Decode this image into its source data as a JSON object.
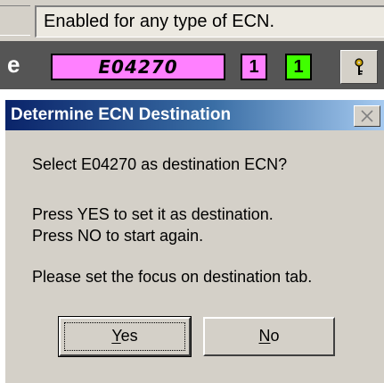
{
  "status_field": {
    "text": "Enabled for any type of ECN."
  },
  "toolbar": {
    "partial_letter": "e",
    "ecn_number": "E04270",
    "count_pink": "1",
    "count_green": "1",
    "key_icon": "key-icon",
    "colors": {
      "band": "#555555",
      "ecn_box": "#ff80ff",
      "count_pink": "#ff80ff",
      "count_green": "#40ff00"
    }
  },
  "dialog": {
    "title": "Determine ECN Destination",
    "close_icon": "close-icon",
    "question": "Select E04270 as destination ECN?",
    "instruction_yes": "Press YES to set it as destination.",
    "instruction_no": "Press NO to start again.",
    "focus_hint": "Please set the focus on destination tab.",
    "buttons": {
      "yes": {
        "mnemonic": "Y",
        "rest": "es"
      },
      "no": {
        "mnemonic": "N",
        "rest": "o"
      }
    },
    "colors": {
      "titlebar_start": "#0a246a",
      "titlebar_end": "#a6caf0",
      "body": "#d4d0c8"
    }
  }
}
